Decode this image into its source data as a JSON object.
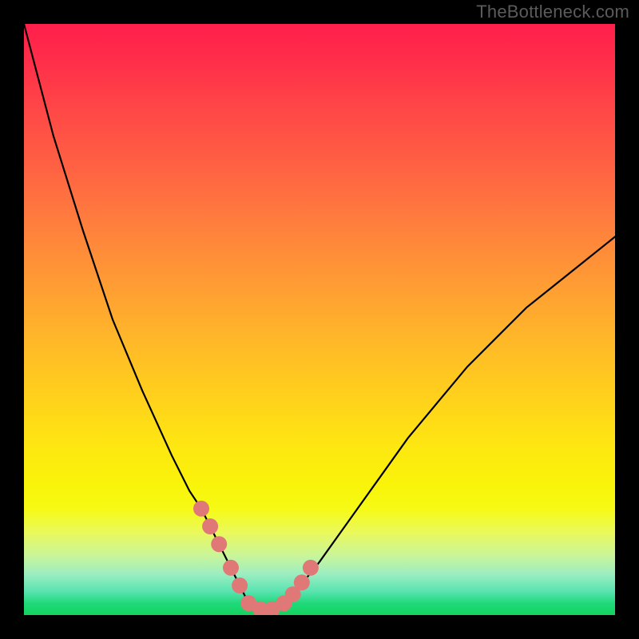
{
  "watermark": "TheBottleneck.com",
  "chart_data": {
    "type": "line",
    "title": "",
    "xlabel": "",
    "ylabel": "",
    "xlim": [
      0,
      100
    ],
    "ylim": [
      0,
      100
    ],
    "series": [
      {
        "name": "bottleneck-curve",
        "x": [
          0,
          5,
          10,
          15,
          20,
          25,
          28,
          30,
          32,
          34,
          36,
          37,
          38,
          40,
          42,
          44,
          46,
          50,
          55,
          60,
          65,
          70,
          75,
          80,
          85,
          90,
          95,
          100
        ],
        "values": [
          100,
          81,
          65,
          50,
          38,
          27,
          21,
          18,
          14,
          10,
          6,
          4,
          2,
          1,
          1,
          2,
          4,
          9,
          16,
          23,
          30,
          36,
          42,
          47,
          52,
          56,
          60,
          64
        ]
      }
    ],
    "markers": {
      "name": "highlight-points",
      "color": "#e07878",
      "x": [
        30,
        31.5,
        33,
        35,
        36.5,
        38,
        40,
        42,
        44,
        45.5,
        47,
        48.5
      ],
      "values": [
        18,
        15,
        12,
        8,
        5,
        2,
        1,
        1,
        2,
        3.5,
        5.5,
        8
      ]
    },
    "gradient_stops": [
      {
        "pos": 0,
        "color": "#ff1f4b"
      },
      {
        "pos": 50,
        "color": "#ffc720"
      },
      {
        "pos": 80,
        "color": "#f9f40a"
      },
      {
        "pos": 100,
        "color": "#14d35d"
      }
    ]
  }
}
